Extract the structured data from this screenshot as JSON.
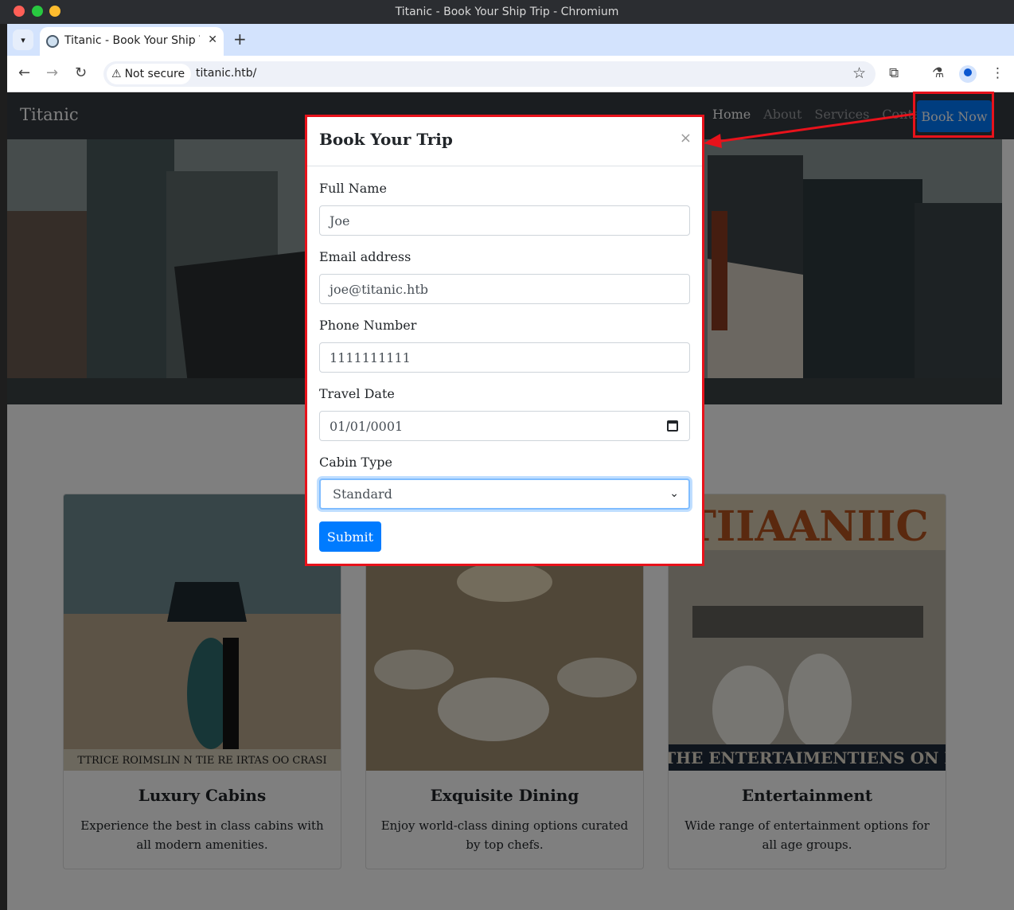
{
  "window": {
    "title": "Titanic - Book Your Ship Trip - Chromium"
  },
  "browser": {
    "tab_title": "Titanic - Book Your Ship Trip",
    "security_label": "Not secure",
    "url": "titanic.htb/"
  },
  "navbar": {
    "brand": "Titanic",
    "links": [
      "Home",
      "About",
      "Services",
      "Contact"
    ],
    "book_button": "Book Now"
  },
  "cards": [
    {
      "title": "Luxury Cabins",
      "text": "Experience the best in class cabins with all modern amenities.",
      "banner": "TTRICE ROIMSLIN N TIE RE IRTAS OO CRASI"
    },
    {
      "title": "Exquisite Dining",
      "text": "Enjoy world-class dining options curated by top chefs."
    },
    {
      "title": "Entertainment",
      "text": "Wide range of entertainment options for all age groups.",
      "banner": "E THE ENTERTAIMENTIENS ON LA",
      "headline": "TIIAANIIC"
    }
  ],
  "modal": {
    "title": "Book Your Trip",
    "close": "×",
    "fields": {
      "name_label": "Full Name",
      "name_value": "Joe",
      "email_label": "Email address",
      "email_value": "joe@titanic.htb",
      "phone_label": "Phone Number",
      "phone_value": "1111111111",
      "date_label": "Travel Date",
      "date_value": "01/01/0001",
      "cabin_label": "Cabin Type",
      "cabin_value": "Standard"
    },
    "submit": "Submit"
  },
  "colors": {
    "primary": "#007bff",
    "navbar": "#343a40",
    "annotation": "#e8121b"
  }
}
